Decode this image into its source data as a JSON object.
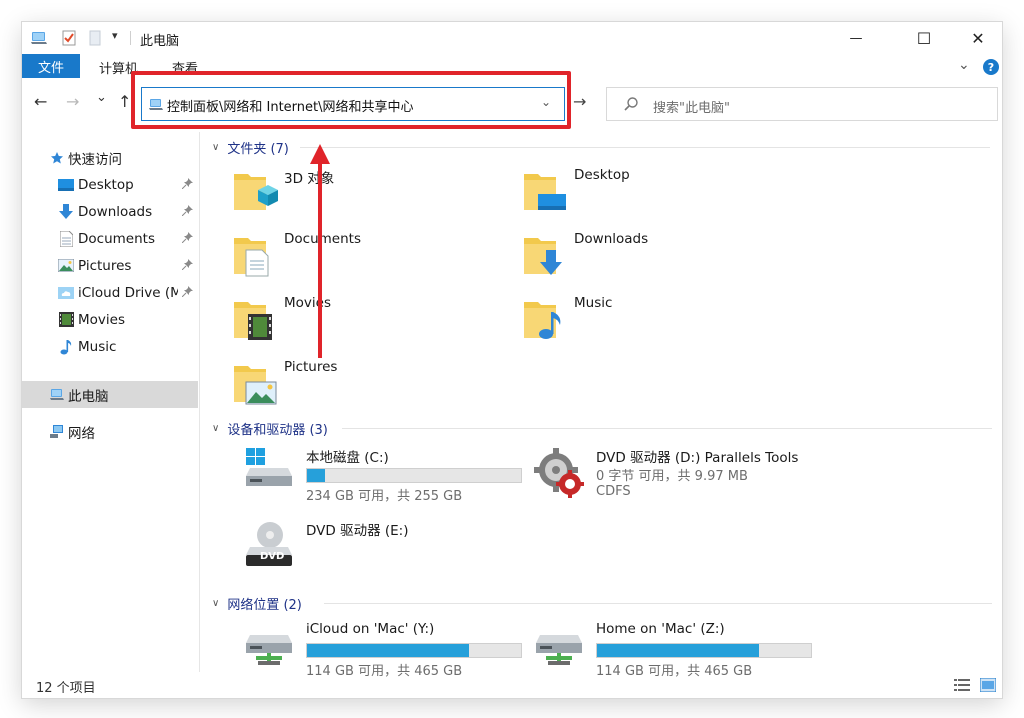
{
  "window": {
    "title": "此电脑",
    "qat_menu_glyph": "▾",
    "controls": {
      "minimize": "—",
      "maximize": "☐",
      "close": "✕"
    }
  },
  "ribbon": {
    "file_tab": "文件",
    "tabs": [
      "计算机",
      "查看"
    ],
    "collapse_glyph": "⌄",
    "help_glyph": "?"
  },
  "nav": {
    "back": "←",
    "forward": "→",
    "recent": "⌄",
    "up": "↑",
    "go": "→",
    "address_path": "控制面板\\网络和 Internet\\网络和共享中心",
    "address_dropdown": "⌄",
    "search_placeholder": "搜索\"此电脑\""
  },
  "sidebar": {
    "quick_access": "快速访问",
    "pinned": [
      {
        "label": "Desktop",
        "icon": "desktop-icon"
      },
      {
        "label": "Downloads",
        "icon": "download-arrow-icon"
      },
      {
        "label": "Documents",
        "icon": "document-icon"
      },
      {
        "label": "Pictures",
        "icon": "picture-icon"
      },
      {
        "label": "iCloud Drive (M",
        "icon": "cloud-folder-icon"
      }
    ],
    "unpinned": [
      {
        "label": "Movies",
        "icon": "film-icon"
      },
      {
        "label": "Music",
        "icon": "music-note-icon"
      }
    ],
    "this_pc": "此电脑",
    "network": "网络",
    "pin_glyph": "📌"
  },
  "groups": {
    "folders_header": "文件夹 (7)",
    "devices_header": "设备和驱动器 (3)",
    "network_header": "网络位置 (2)"
  },
  "folders": [
    {
      "label": "3D 对象",
      "overlay": "cube-3d-icon"
    },
    {
      "label": "Desktop",
      "overlay": "desktop-icon"
    },
    {
      "label": "Documents",
      "overlay": "document-icon"
    },
    {
      "label": "Downloads",
      "overlay": "download-arrow-icon"
    },
    {
      "label": "Movies",
      "overlay": "film-icon"
    },
    {
      "label": "Music",
      "overlay": "music-note-icon"
    },
    {
      "label": "Pictures",
      "overlay": "picture-icon"
    }
  ],
  "drives": [
    {
      "name": "本地磁盘 (C:)",
      "info": "234 GB 可用，共 255 GB",
      "used_fraction": 0.082,
      "bar_color": "#26a0da",
      "icon": "windows-drive-icon"
    },
    {
      "name": "DVD 驱动器 (D:) Parallels Tools",
      "line2": "0 字节 可用，共 9.97 MB",
      "line3": "CDFS",
      "icon": "dvd-autorun-gear-icon"
    },
    {
      "name": "DVD 驱动器 (E:)",
      "icon": "dvd-drive-icon",
      "dvd_label": "DVD"
    }
  ],
  "network_locations": [
    {
      "name": "iCloud on 'Mac' (Y:)",
      "info": "114 GB 可用，共 465 GB",
      "used_fraction": 0.755,
      "icon": "network-drive-icon"
    },
    {
      "name": "Home on 'Mac' (Z:)",
      "info": "114 GB 可用，共 465 GB",
      "used_fraction": 0.755,
      "icon": "network-drive-icon"
    }
  ],
  "status": {
    "item_count": "12 个项目"
  },
  "colors": {
    "accent": "#1979ca",
    "annotation": "#e0242a",
    "group_header": "#1e3287",
    "bar_fill": "#26a0da"
  }
}
